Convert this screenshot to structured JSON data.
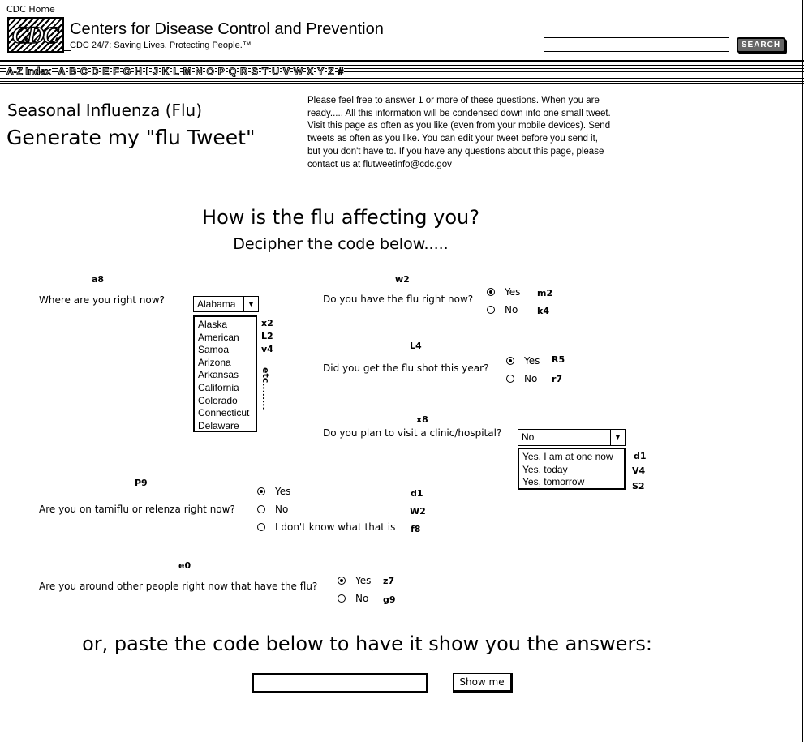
{
  "header": {
    "home_link": "CDC Home",
    "logo_text": "CDC",
    "site_title": "Centers for Disease Control and Prevention",
    "tagline": "CDC 24/7: Saving Lives. Protecting People.™",
    "search_placeholder": "",
    "search_button": "SEARCH"
  },
  "az_nav": {
    "index_label": "A-Z Index",
    "letters": [
      "A",
      "B",
      "C",
      "D",
      "E",
      "F",
      "G",
      "H",
      "I",
      "J",
      "K",
      "L",
      "M",
      "N",
      "O",
      "P",
      "Q",
      "R",
      "S",
      "T",
      "U",
      "V",
      "W",
      "X",
      "Y",
      "Z",
      "#"
    ]
  },
  "intro": {
    "section_title": "Seasonal Influenza (Flu)",
    "page_heading": "Generate my \"flu Tweet\"",
    "lines": [
      "Please feel free to answer 1 or more of these questions.  When you are",
      "ready.....  All this information will be condensed down into one small tweet.",
      "Visit this page as often as you like (even from your mobile devices).  Send",
      "tweets as often as you like.   You can edit your tweet before you send it,",
      "but you don't have to.  If you have any questions about this page, please",
      "contact us at flutweetinfo@cdc.gov"
    ]
  },
  "form_heading": "How is the flu affecting you?",
  "form_subheading": "Decipher the code below.....",
  "q_location": {
    "code": "a8",
    "label": "Where are you right now?",
    "selected": "Alabama",
    "options": [
      "Alaska",
      "American",
      "Samoa",
      "Arizona",
      "Arkansas",
      "California",
      "Colorado",
      "Connecticut",
      "Delaware"
    ],
    "codes": [
      "x2",
      "L2",
      "v4"
    ],
    "etc": "etc........"
  },
  "q_have_flu": {
    "code": "w2",
    "label": "Do you have the flu right now?",
    "options": [
      {
        "label": "Yes",
        "code": "m2",
        "checked": true
      },
      {
        "label": "No",
        "code": "k4",
        "checked": false
      }
    ]
  },
  "q_flu_shot": {
    "code": "L4",
    "label": "Did you get the flu shot this year?",
    "options": [
      {
        "label": "Yes",
        "code": "R5",
        "checked": true
      },
      {
        "label": "No",
        "code": "r7",
        "checked": false
      }
    ]
  },
  "q_clinic": {
    "code": "x8",
    "label": "Do you plan to visit a clinic/hospital?",
    "selected": "No",
    "options": [
      {
        "label": "Yes, I am at one now",
        "code": "d1"
      },
      {
        "label": "Yes, today",
        "code": "V4"
      },
      {
        "label": "Yes, tomorrow",
        "code": "S2"
      }
    ]
  },
  "q_tamiflu": {
    "code": "P9",
    "label": "Are you on tamiflu or relenza right now?",
    "options": [
      {
        "label": "Yes",
        "code": "d1",
        "checked": true
      },
      {
        "label": "No",
        "code": "W2",
        "checked": false
      },
      {
        "label": "I don't know what that is",
        "code": "f8",
        "checked": false
      }
    ]
  },
  "q_around": {
    "code": "e0",
    "label": "Are you around other people right now that have the flu?",
    "options": [
      {
        "label": "Yes",
        "code": "z7",
        "checked": true
      },
      {
        "label": "No",
        "code": "g9",
        "checked": false
      }
    ]
  },
  "paste": {
    "heading": "or, paste the code below to have it show you the answers:",
    "input_value": "",
    "button": "Show me"
  }
}
